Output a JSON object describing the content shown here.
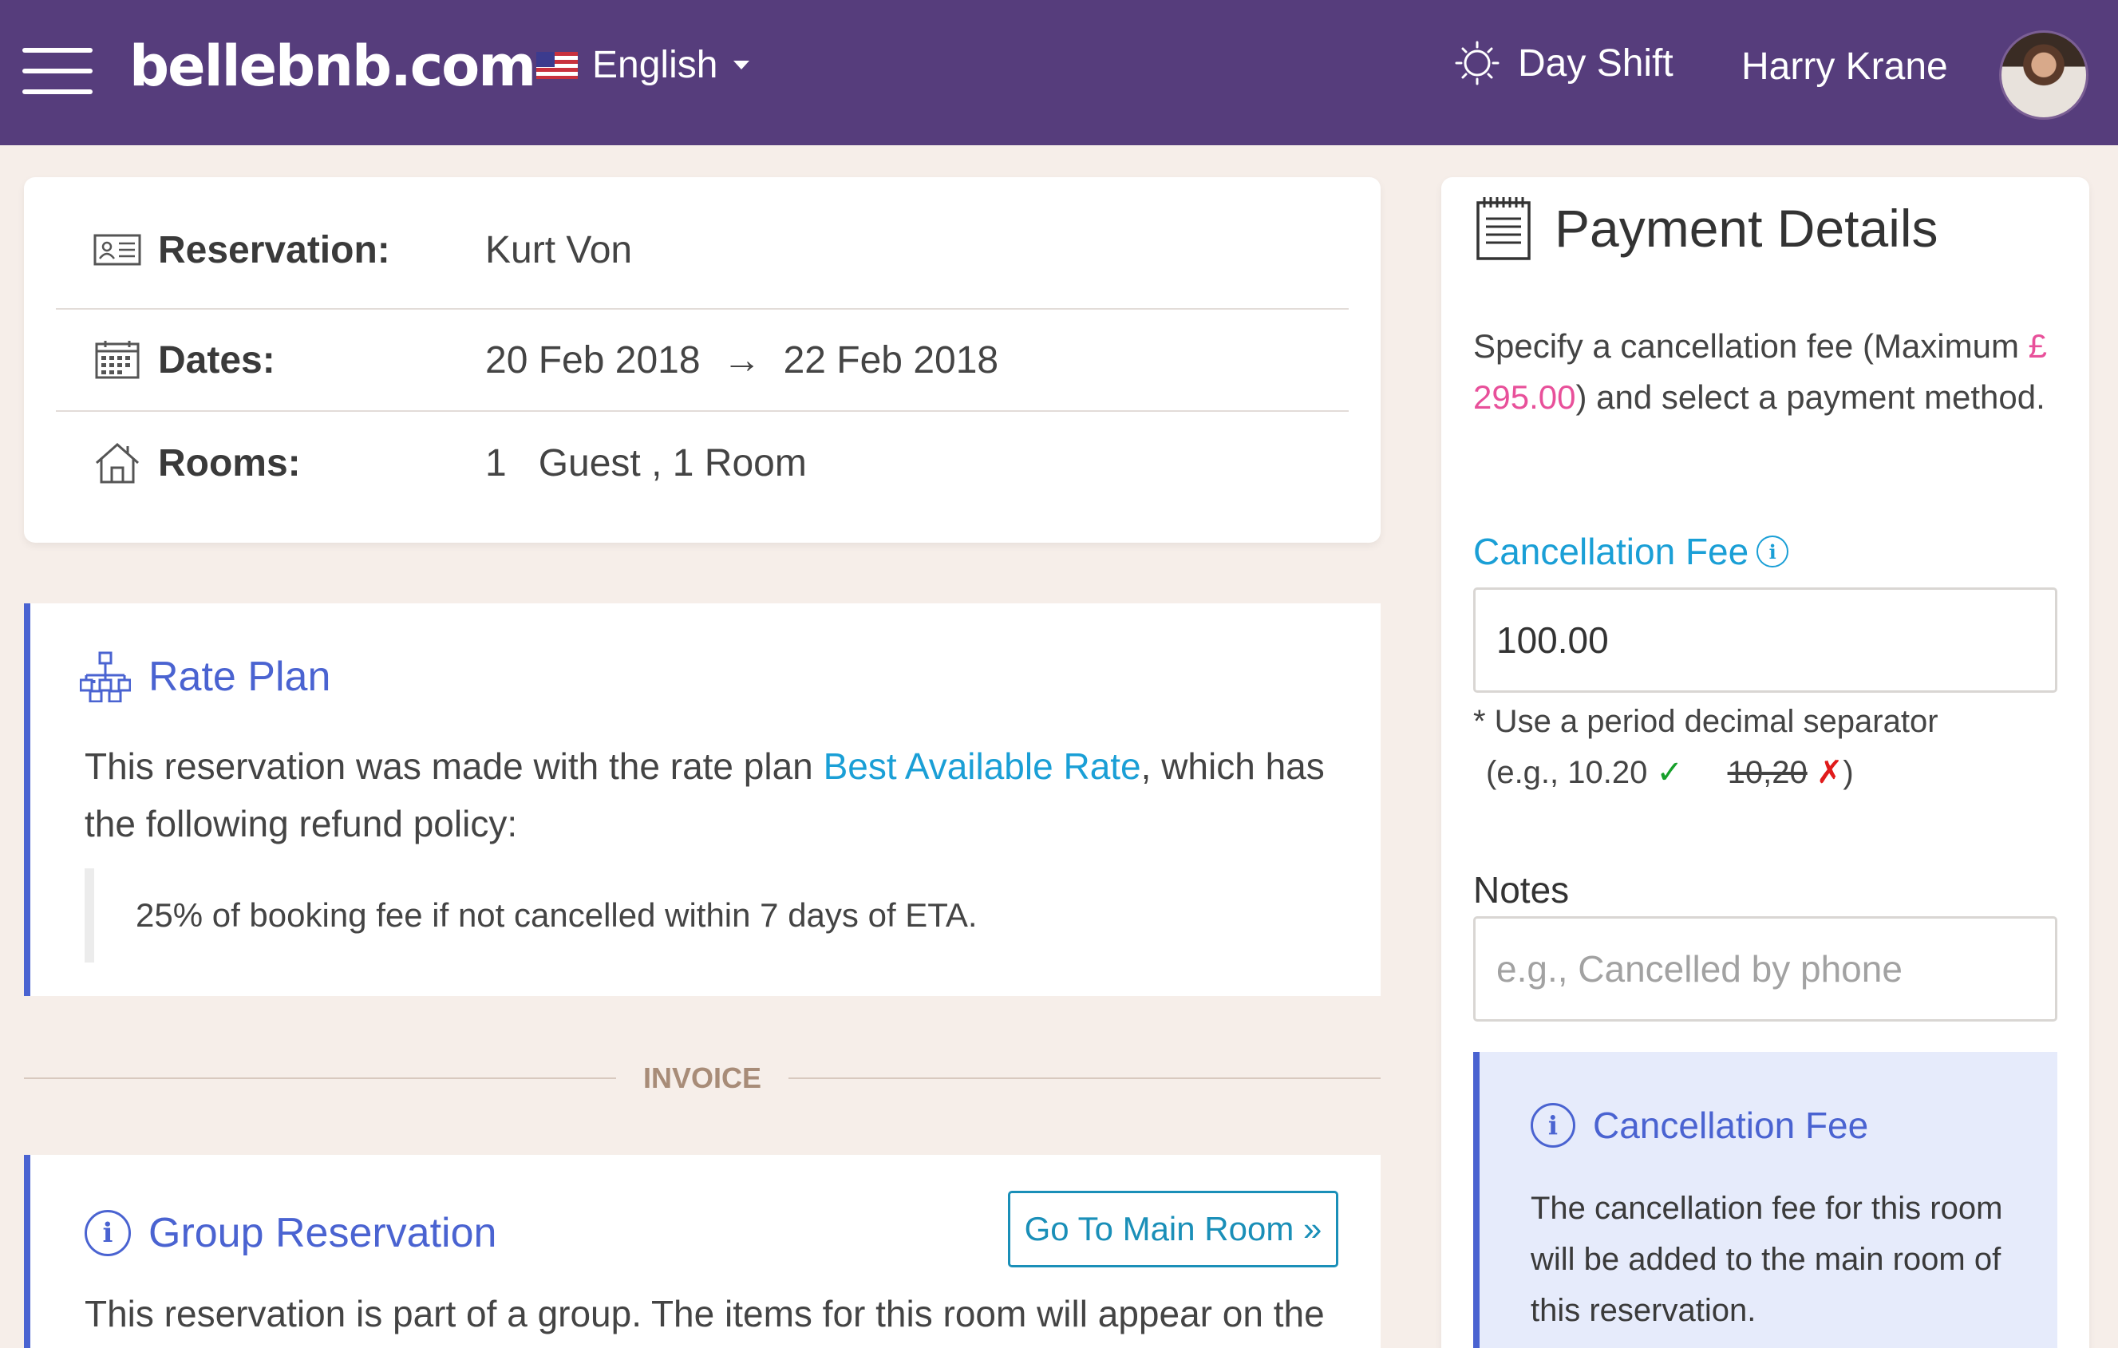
{
  "header": {
    "brand": "bellebnb.com",
    "language": "English",
    "shift": "Day Shift",
    "user_name": "Harry Krane"
  },
  "reservation": {
    "reservation_label": "Reservation:",
    "guest_name": "Kurt Von",
    "dates_label": "Dates:",
    "date_from": "20 Feb 2018",
    "arrow": "→",
    "date_to": "22 Feb 2018",
    "rooms_label": "Rooms:",
    "rooms_value": "1   Guest , 1 Room"
  },
  "rate_plan": {
    "title": "Rate Plan",
    "text_before": "This reservation was made with the rate plan ",
    "plan_link": "Best Available Rate",
    "text_after": ", which has the following refund policy:",
    "policy": "25% of booking fee if not cancelled within 7 days of ETA."
  },
  "invoice_divider": "INVOICE",
  "group_reservation": {
    "title": "Group Reservation",
    "button": "Go To Main Room »",
    "text": "This reservation is part of a group. The items for this room will appear on the"
  },
  "payment": {
    "title": "Payment Details",
    "desc_before": "Specify a cancellation fee (Maximum ",
    "max_amount": "£ 295.00",
    "desc_after": ") and select a payment method.",
    "fee_label": "Cancellation Fee",
    "fee_value": "100.00",
    "hint_line1": "* Use a period decimal separator",
    "hint_open": "(e.g., 10.20",
    "hint_ok": "✓",
    "hint_bad_example": "10,20",
    "hint_bad": "✗",
    "hint_close": ")",
    "notes_label": "Notes",
    "notes_placeholder": "e.g., Cancelled by phone",
    "info_title": "Cancellation Fee",
    "info_text": "The cancellation fee for this room will be added to the main room of this reservation."
  },
  "colors": {
    "topbar": "#563d7c",
    "accent_blue": "#4a63d1",
    "link_blue": "#1a9fd6",
    "max_pink": "#e8509a",
    "background": "#f6eee9"
  }
}
